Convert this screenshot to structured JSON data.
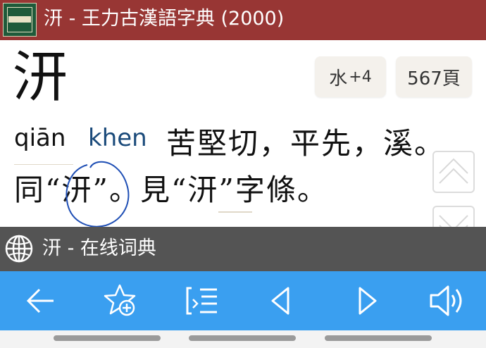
{
  "header": {
    "title": "汧 - 王力古漢語字典 (2000)",
    "app_icon": "book-cover-icon"
  },
  "entry": {
    "headword": "汧",
    "radical": "水",
    "stroke_extra": "+4",
    "page": "567頁",
    "pinyin": "qiān",
    "romanization": "khen",
    "fanqie": "苦堅切，平先，溪。",
    "definition": "同“汧”。見“汧”字條。"
  },
  "online": {
    "label": "汧 - 在线词典",
    "icon": "globe-icon"
  },
  "toolbar": {
    "icons": [
      "back-arrow-icon",
      "star-add-icon",
      "list-icon",
      "previous-triangle-icon",
      "next-triangle-icon",
      "speaker-icon"
    ]
  },
  "colors": {
    "titlebar": "#983634",
    "toolbar": "#3a9ff0",
    "online_bar": "#545454",
    "romanization": "#1a4a7a",
    "annotation": "#1f4fb5"
  }
}
